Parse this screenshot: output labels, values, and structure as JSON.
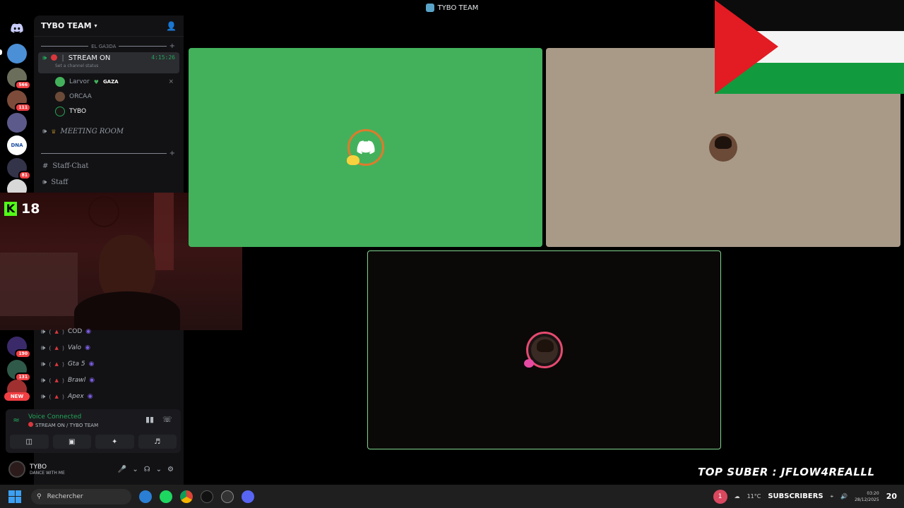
{
  "window": {
    "title": "TYBO TEAM"
  },
  "server_rail": {
    "badges": [
      "566",
      "111",
      "81",
      "190",
      "131"
    ],
    "new_label": "NEW",
    "server_labels": [
      "DNA"
    ]
  },
  "sidebar": {
    "server_name": "TYBO TEAM",
    "category_1": "EL GA3DA",
    "stream_channel": {
      "name": "STREAM ON",
      "timer": "4:15:26",
      "status_hint": "Set a channel status"
    },
    "members": [
      {
        "name": "Larvor",
        "tag": "GAZA"
      },
      {
        "name": "ORCAA",
        "tag": ""
      },
      {
        "name": "TYBO",
        "tag": ""
      }
    ],
    "meeting_room": "MEETING ROOM",
    "text_channels": [
      "Staff-Chat",
      "Staff"
    ],
    "game_channels": [
      "COD",
      "Valo",
      "Gta 5",
      "Brawl",
      "Apex"
    ]
  },
  "webcam": {
    "kick_logo": "K",
    "viewer_count": "18"
  },
  "voice_panel": {
    "status": "Voice Connected",
    "channel": "STREAM ON / TYBO TEAM"
  },
  "user_panel": {
    "username": "TYBO",
    "status": "DANCE WITH ME"
  },
  "overlay": {
    "top_suber": "TOP SUBER : JFLOW4REALLL"
  },
  "taskbar": {
    "search_placeholder": "Rechercher",
    "notification_count": "1",
    "weather": "11°C",
    "subscribers_label": "SUBSCRIBERS",
    "time": "03:20",
    "date": "28/12/2025",
    "clock_big": "20"
  },
  "colors": {
    "accent_green": "#43b15c",
    "speaking_border": "#7fd68f",
    "voice_connected": "#23a559",
    "kick_green": "#53fc18",
    "danger": "#f23f43"
  },
  "icons": {
    "discord_home": "discord-icon",
    "add_member": "add-user-icon",
    "speaker": "speaker-icon",
    "hash": "hash-icon",
    "mic": "mic-icon",
    "headphones": "headphones-icon",
    "settings": "gear-icon",
    "hangup": "disconnect-icon"
  }
}
